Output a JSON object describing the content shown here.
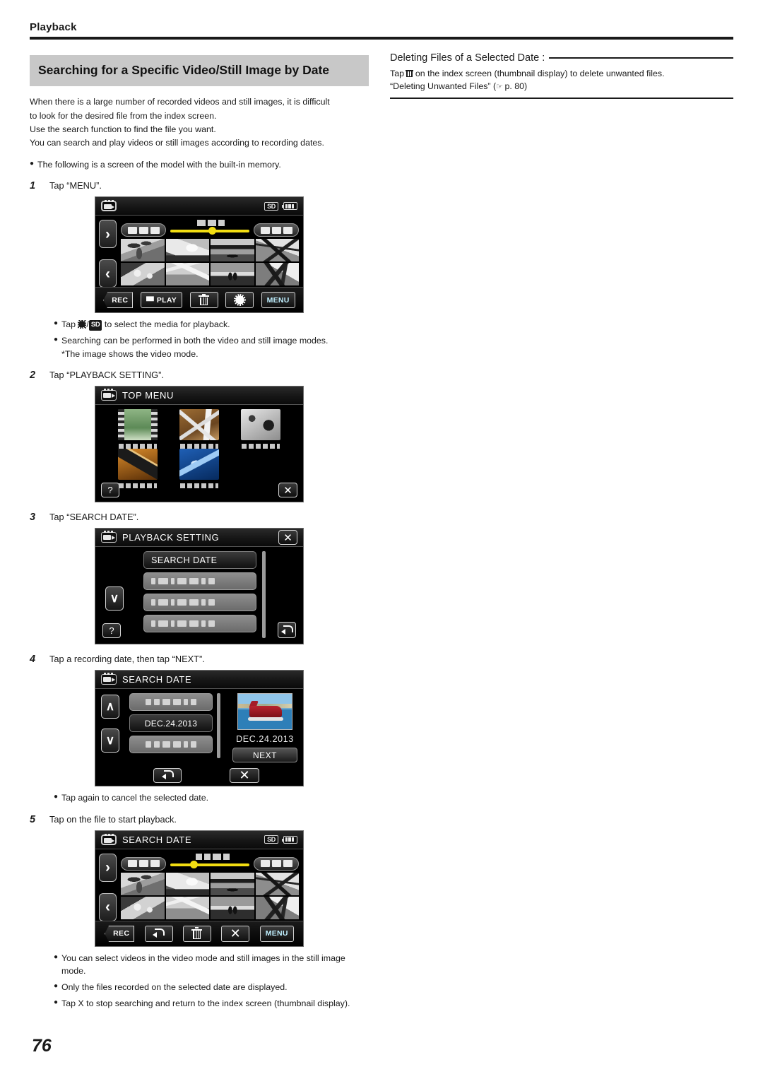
{
  "header": {
    "chapter": "Playback"
  },
  "page_number": "76",
  "left": {
    "section_title": "Searching for a Specific Video/Still Image by Date",
    "intro_lines": [
      "When there is a large number of recorded videos and still images, it is difficult",
      "to look for the desired file from the index screen.",
      "Use the search function to find the file you want.",
      "You can search and play videos or still images according to recording dates."
    ],
    "intro_bullet": "The following is a screen of the model with the built-in memory.",
    "steps": [
      {
        "num": "1",
        "text": "Tap “MENU”."
      },
      {
        "num": "2",
        "text": "Tap “PLAYBACK SETTING”."
      },
      {
        "num": "3",
        "text": "Tap “SEARCH DATE”."
      },
      {
        "num": "4",
        "text": "Tap a recording date, then tap “NEXT”."
      },
      {
        "num": "5",
        "text": "Tap on the file to start playback."
      }
    ],
    "notes_after_step1": [
      {
        "pre": "Tap ",
        "icon_gear": "gear-icon",
        "sep": "/",
        "icon_sd": "SD",
        "post": " to select the media for playback."
      },
      {
        "text": "Searching can be performed in both the video and still image modes.",
        "sub": "*The image shows the video mode."
      }
    ],
    "note_after_step4": "Tap again to cancel the selected date.",
    "notes_after_step5": [
      "You can select videos in the video mode and still images in the still image mode.",
      "Only the files recorded on the selected date are displayed.",
      "Tap X to stop searching and return to the index screen (thumbnail display)."
    ]
  },
  "right": {
    "tip_title": "Deleting Files of a Selected Date :",
    "tip_line1_pre": "Tap ",
    "tip_line1_post": " on the index screen (thumbnail display) to delete unwanted files.",
    "tip_line2_quote": "“Deleting Unwanted Files”",
    "tip_line2_ref": "p. 80"
  },
  "screens": {
    "index": {
      "title": "",
      "status": {
        "sd": "SD",
        "battery": "battery-full"
      },
      "buttons": [
        {
          "name": "rec",
          "label": "REC"
        },
        {
          "name": "play",
          "label": "PLAY"
        },
        {
          "name": "trash",
          "label": ""
        },
        {
          "name": "gear",
          "label": ""
        },
        {
          "name": "menu",
          "label": "MENU"
        }
      ]
    },
    "top_menu": {
      "title": "TOP MENU",
      "items": [
        {
          "name": "recording-menu"
        },
        {
          "name": "edit-menu"
        },
        {
          "name": "setup-menu"
        },
        {
          "name": "connection-menu"
        },
        {
          "name": "disc-menu"
        }
      ],
      "help_label": "?",
      "close_label": "✕"
    },
    "playback_setting": {
      "title": "PLAYBACK SETTING",
      "close_label": "✕",
      "rows": [
        {
          "label": "SEARCH DATE",
          "selected": true
        },
        {
          "label": "",
          "selected": false
        },
        {
          "label": "",
          "selected": false
        },
        {
          "label": "",
          "selected": false
        }
      ],
      "help_label": "?",
      "down_label": "∨"
    },
    "search_date": {
      "title": "SEARCH DATE",
      "rows": [
        {
          "label": "",
          "selected": false
        },
        {
          "label": "DEC.24.2013",
          "selected": true
        },
        {
          "label": "",
          "selected": false
        }
      ],
      "preview_date": "DEC.24.2013",
      "next_label": "NEXT",
      "up_label": "∧",
      "down_label": "∨"
    },
    "search_date_index": {
      "title": "SEARCH DATE",
      "status": {
        "sd": "SD",
        "battery": "battery-full"
      },
      "buttons": [
        {
          "name": "rec",
          "label": "REC"
        },
        {
          "name": "back",
          "label": ""
        },
        {
          "name": "trash",
          "label": ""
        },
        {
          "name": "close",
          "label": ""
        },
        {
          "name": "menu",
          "label": "MENU"
        }
      ]
    }
  }
}
